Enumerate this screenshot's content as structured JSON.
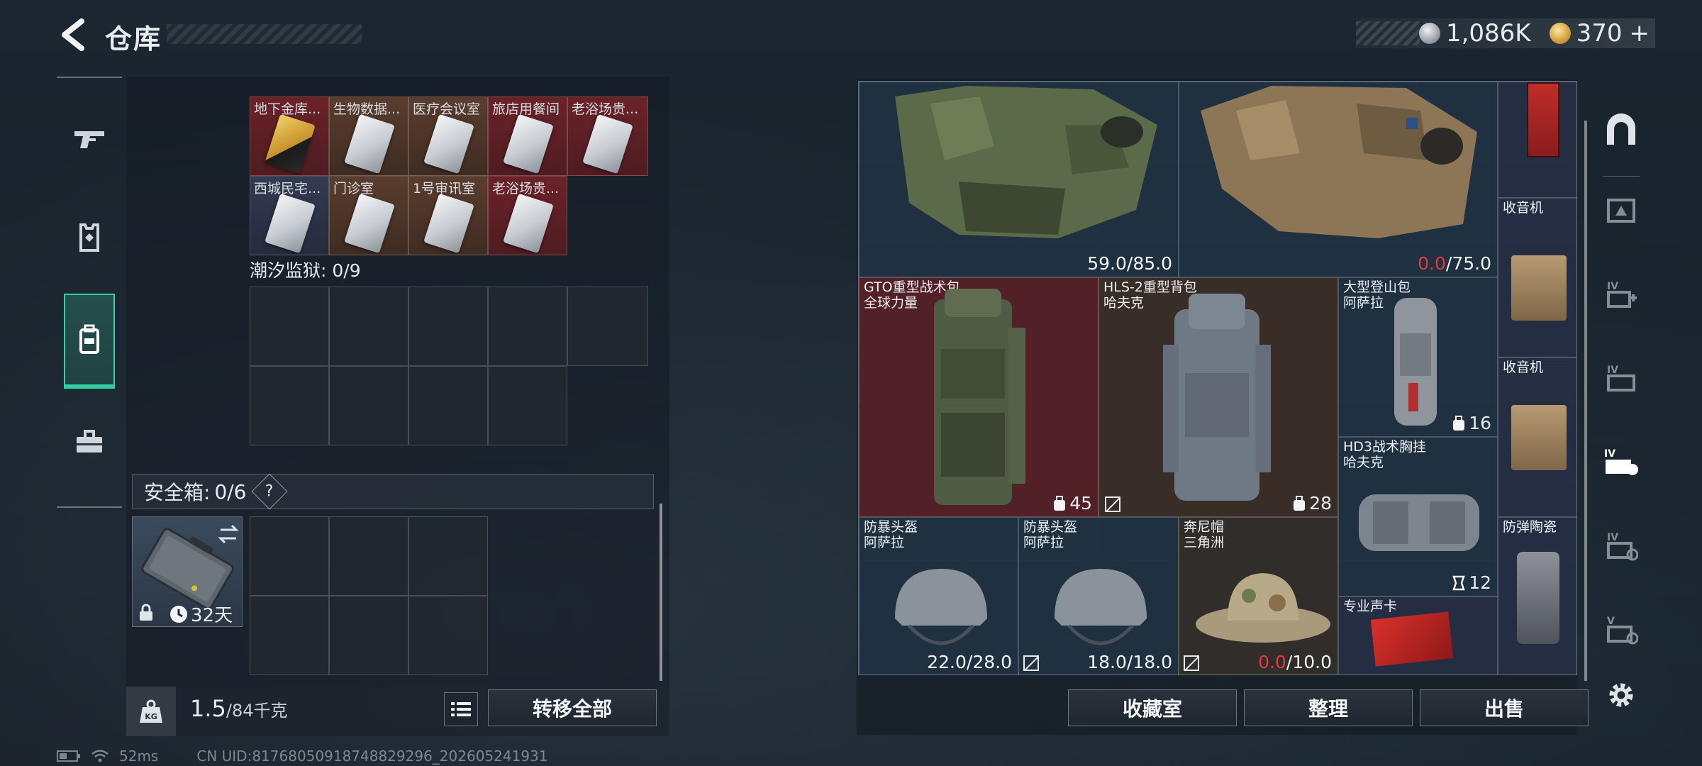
{
  "header": {
    "title": "仓库"
  },
  "currency": {
    "coins": "1,086K",
    "gems": "370",
    "gems_plus": "+"
  },
  "left_nav": [
    "weapons",
    "armor",
    "backpack-storage",
    "toolbox"
  ],
  "storage": {
    "row1": [
      "地下金库...",
      "生物数据...",
      "医疗会议室",
      "旅店用餐间",
      "老浴场贵..."
    ],
    "row2": [
      "西城民宅...",
      "门诊室",
      "1号审讯室",
      "老浴场贵..."
    ],
    "prison_label": "潮汐监狱: 0/9"
  },
  "safebox": {
    "label": "安全箱:",
    "count": "0/6",
    "help": "?",
    "time_left": "32天"
  },
  "weight": {
    "current": "1.5",
    "max": "/84千克"
  },
  "buttons": {
    "transfer_all": "转移全部",
    "collection": "收藏室",
    "organize": "整理",
    "sell": "出售"
  },
  "items": {
    "vest1_dur": "59.0/85.0",
    "vest2_dur_cur": "0.0",
    "vest2_dur_max": "/75.0",
    "radio1": "收音机",
    "radio2": "收音机",
    "bag1_name": "GTO重型战术包",
    "bag1_maker": "全球力量",
    "bag1_cap": "45",
    "bag2_name": "HLS-2重型背包",
    "bag2_maker": "哈夫克",
    "bag2_cap": "28",
    "bag3_name": "大型登山包",
    "bag3_maker": "阿萨拉",
    "bag3_cap": "16",
    "rig_name": "HD3战术胸挂",
    "rig_maker": "哈夫克",
    "rig_cap": "12",
    "plate": "防弹陶瓷",
    "helmet1_name": "防暴头盔",
    "helmet1_maker": "阿萨拉",
    "helmet1_dur": "22.0/28.0",
    "helmet2_name": "防暴头盔",
    "helmet2_maker": "阿萨拉",
    "helmet2_dur": "18.0/18.0",
    "hat_name": "奔尼帽",
    "hat_maker": "三角洲",
    "hat_dur_cur": "0.0",
    "hat_dur_max": "/10.0",
    "gpu": "专业声卡"
  },
  "footer": {
    "ping": "52ms",
    "uid": "CN UID:8176805091874882929​6_202605241931"
  },
  "colors": {
    "accent": "#2fd3a2",
    "danger": "#e23a3a"
  }
}
